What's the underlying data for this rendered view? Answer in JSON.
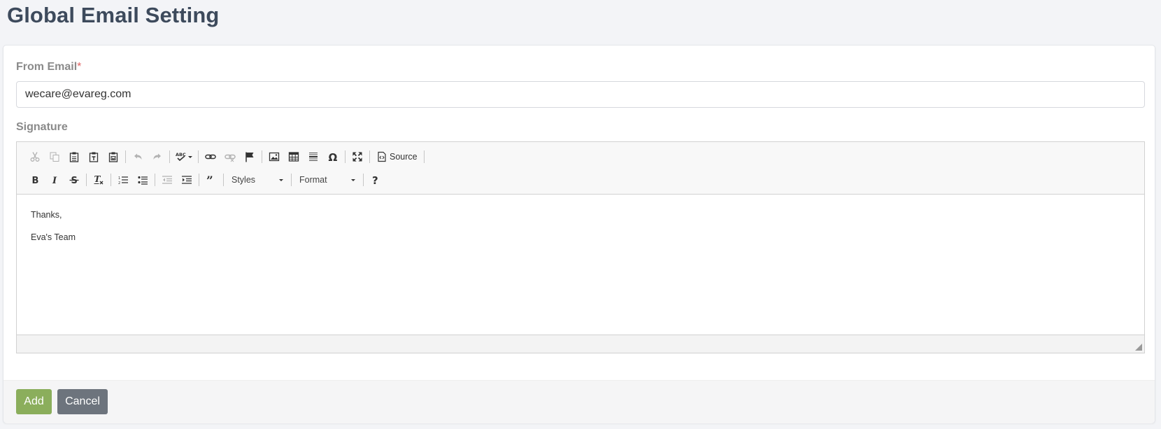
{
  "page": {
    "title": "Global Email Setting"
  },
  "form": {
    "from_email": {
      "label": "From Email",
      "required_mark": "*",
      "value": "wecare@evareg.com"
    },
    "signature": {
      "label": "Signature",
      "content": [
        "Thanks,",
        "Eva's Team"
      ]
    }
  },
  "editor": {
    "toolbar_row1": [
      "cut-icon",
      "copy-icon",
      "paste-icon",
      "paste-text-icon",
      "paste-word-icon",
      "undo-icon",
      "redo-icon",
      "spellcheck-icon",
      "link-icon",
      "unlink-icon",
      "anchor-icon",
      "image-icon",
      "table-icon",
      "horizontal-rule-icon",
      "special-char-icon",
      "maximize-icon",
      "source-icon"
    ],
    "source_label": "Source",
    "toolbar_row2": [
      "bold-icon",
      "italic-icon",
      "strikethrough-icon",
      "remove-format-icon",
      "numbered-list-icon",
      "bulleted-list-icon",
      "outdent-icon",
      "indent-icon",
      "blockquote-icon",
      "help-icon"
    ],
    "styles_label": "Styles",
    "format_label": "Format"
  },
  "actions": {
    "add_label": "Add",
    "cancel_label": "Cancel"
  },
  "colors": {
    "add": "#8bae5c",
    "cancel": "#6d747d",
    "title": "#3d4a5c",
    "required": "#e06363"
  }
}
